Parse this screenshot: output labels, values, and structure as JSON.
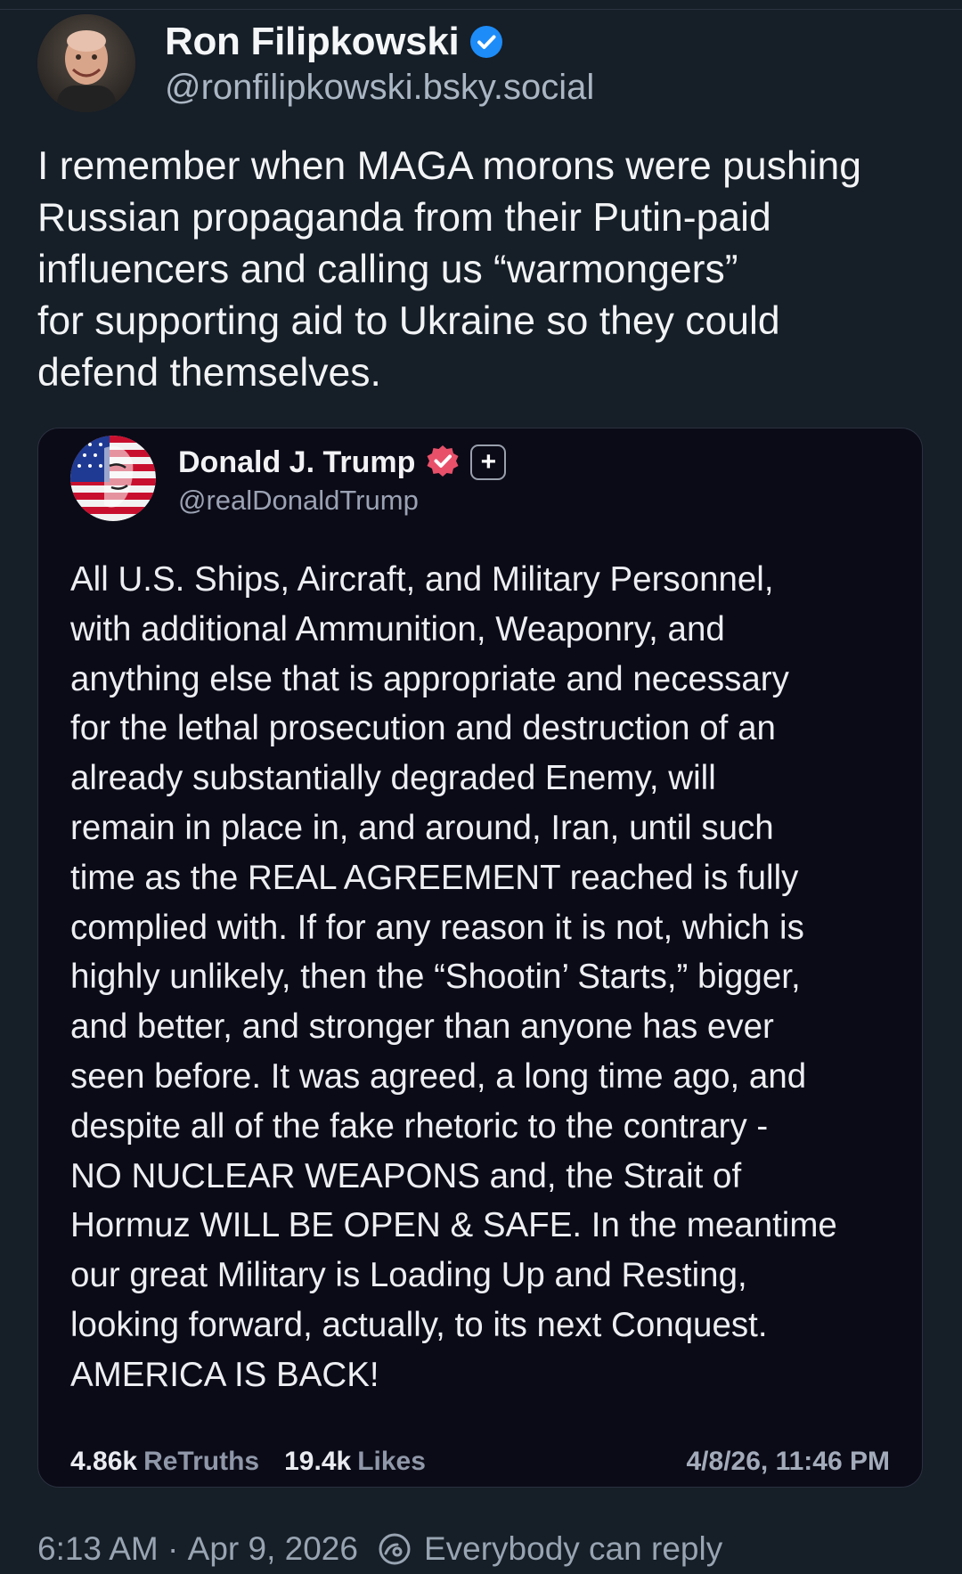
{
  "post": {
    "author": {
      "name": "Ron Filipkowski",
      "handle": "@ronfilipkowski.bsky.social",
      "avatar_icon": "author-avatar",
      "verified_icon": "verified-check-icon",
      "verified_color": "#1d8cf8"
    },
    "text_lines": [
      "I remember when MAGA morons were pushing",
      "Russian propaganda from their Putin-paid",
      "influencers and calling us “warmongers”",
      "for supporting aid to Ukraine so they could",
      "defend themselves."
    ],
    "quote": {
      "author": {
        "name": "Donald J. Trump",
        "handle": "@realDonaldTrump",
        "avatar_icon": "flag-portrait-avatar",
        "badge_icon": "truth-verified-badge-icon",
        "badge_color": "#e8506a",
        "plus_icon": "plus-badge-icon",
        "plus_symbol": "+"
      },
      "text_lines": [
        "All U.S. Ships, Aircraft, and Military Personnel,",
        "with additional Ammunition, Weaponry, and",
        "anything else that is appropriate and necessary",
        "for the lethal prosecution and destruction of an",
        "already substantially degraded Enemy, will",
        "remain in place in, and around, Iran, until such",
        "time as the REAL AGREEMENT reached is fully",
        "complied with. If for any reason it is not, which is",
        "highly unlikely, then the “Shootin’ Starts,” bigger,",
        "and better, and stronger than anyone has ever",
        "seen before. It was agreed, a long time ago, and",
        "despite all of the fake rhetoric to the contrary -",
        "NO NUCLEAR WEAPONS and, the Strait of",
        "Hormuz WILL BE OPEN & SAFE. In the meantime",
        "our great Military is Loading Up and Resting,",
        "looking forward, actually, to its next Conquest.",
        "AMERICA IS BACK!"
      ],
      "stats": {
        "retruths_count": "4.86k",
        "retruths_label": "ReTruths",
        "likes_count": "19.4k",
        "likes_label": "Likes"
      },
      "date": "4/8/26, 11:46 PM"
    },
    "footer": {
      "time": "6:13 AM",
      "separator": "·",
      "date": "Apr 9, 2026",
      "reply_icon": "reply-permission-icon",
      "reply_setting": "Everybody can reply"
    }
  },
  "colors": {
    "background": "#161e27",
    "card_background": "#0b0b17",
    "secondary_text": "#aab6c3"
  }
}
